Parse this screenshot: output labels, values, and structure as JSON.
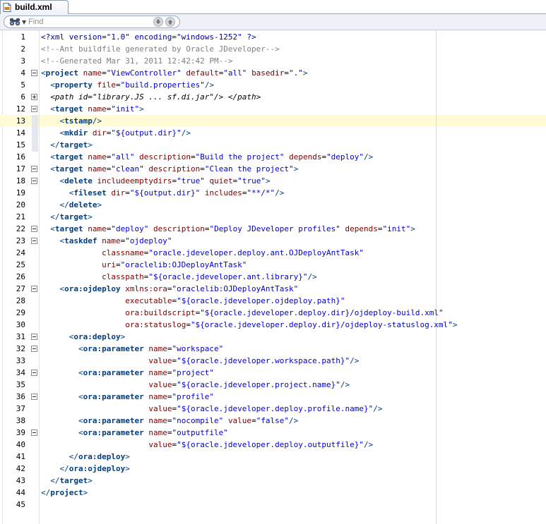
{
  "tab": {
    "title": "build.xml",
    "icon": "xml-file-icon"
  },
  "find": {
    "placeholder": "Find",
    "icon": "binoculars-icon"
  },
  "colors": {
    "tag": "#003d80",
    "attribute": "#7a0000",
    "value": "#0000d0",
    "comment": "#7f7f7f",
    "current_line": "#fffbd6"
  },
  "editor": {
    "lines": [
      {
        "n": "1",
        "fold": "",
        "t": [
          [
            "pi",
            "<?xml version=\"1.0\" encoding=\"windows-1252\" ?>"
          ]
        ]
      },
      {
        "n": "2",
        "fold": "",
        "t": [
          [
            "com",
            "<!--Ant buildfile generated by Oracle JDeveloper-->"
          ]
        ]
      },
      {
        "n": "3",
        "fold": "",
        "t": [
          [
            "com",
            "<!--Generated Mar 31, 2011 12:42:42 PM-->"
          ]
        ]
      },
      {
        "n": "4",
        "fold": "minus",
        "t": [
          [
            "br",
            "<"
          ],
          [
            "tag",
            "project"
          ],
          [
            "txt",
            " "
          ],
          [
            "attr",
            "name"
          ],
          [
            "txt",
            "="
          ],
          [
            "val",
            "\"ViewController\""
          ],
          [
            "txt",
            " "
          ],
          [
            "attr",
            "default"
          ],
          [
            "txt",
            "="
          ],
          [
            "val",
            "\"all\""
          ],
          [
            "txt",
            " "
          ],
          [
            "attr",
            "basedir"
          ],
          [
            "txt",
            "="
          ],
          [
            "val",
            "\".\""
          ],
          [
            "br",
            ">"
          ]
        ]
      },
      {
        "n": "5",
        "fold": "",
        "t": [
          [
            "txt",
            "  "
          ],
          [
            "br",
            "<"
          ],
          [
            "tag",
            "property"
          ],
          [
            "txt",
            " "
          ],
          [
            "attr",
            "file"
          ],
          [
            "txt",
            "="
          ],
          [
            "val",
            "\"build.properties\""
          ],
          [
            "br",
            "/>"
          ]
        ]
      },
      {
        "n": "6",
        "fold": "plus",
        "t": [
          [
            "txt",
            "  "
          ],
          [
            "ital",
            "<path id=\"library.JS ... sf.di.jar\"/> </path>"
          ]
        ]
      },
      {
        "n": "12",
        "fold": "minus",
        "t": [
          [
            "txt",
            "  "
          ],
          [
            "br",
            "<"
          ],
          [
            "tag",
            "target"
          ],
          [
            "txt",
            " "
          ],
          [
            "attr",
            "name"
          ],
          [
            "txt",
            "="
          ],
          [
            "val",
            "\"init\""
          ],
          [
            "br",
            ">"
          ]
        ]
      },
      {
        "n": "13",
        "fold": "",
        "t": [
          [
            "txt",
            "    "
          ],
          [
            "br",
            "<"
          ],
          [
            "tag",
            "tstamp"
          ],
          [
            "br",
            "/>"
          ]
        ]
      },
      {
        "n": "14",
        "fold": "",
        "t": [
          [
            "txt",
            "    "
          ],
          [
            "br",
            "<"
          ],
          [
            "tag",
            "mkdir"
          ],
          [
            "txt",
            " "
          ],
          [
            "attr",
            "dir"
          ],
          [
            "txt",
            "="
          ],
          [
            "val",
            "\"${output.dir}\""
          ],
          [
            "br",
            "/>"
          ]
        ]
      },
      {
        "n": "15",
        "fold": "",
        "t": [
          [
            "txt",
            "  "
          ],
          [
            "br",
            "</"
          ],
          [
            "tag",
            "target"
          ],
          [
            "br",
            ">"
          ]
        ]
      },
      {
        "n": "16",
        "fold": "",
        "t": [
          [
            "txt",
            "  "
          ],
          [
            "br",
            "<"
          ],
          [
            "tag",
            "target"
          ],
          [
            "txt",
            " "
          ],
          [
            "attr",
            "name"
          ],
          [
            "txt",
            "="
          ],
          [
            "val",
            "\"all\""
          ],
          [
            "txt",
            " "
          ],
          [
            "attr",
            "description"
          ],
          [
            "txt",
            "="
          ],
          [
            "val",
            "\"Build the project\""
          ],
          [
            "txt",
            " "
          ],
          [
            "attr",
            "depends"
          ],
          [
            "txt",
            "="
          ],
          [
            "val",
            "\"deploy\""
          ],
          [
            "br",
            "/>"
          ]
        ]
      },
      {
        "n": "17",
        "fold": "minus",
        "t": [
          [
            "txt",
            "  "
          ],
          [
            "br",
            "<"
          ],
          [
            "tag",
            "target"
          ],
          [
            "txt",
            " "
          ],
          [
            "attr",
            "name"
          ],
          [
            "txt",
            "="
          ],
          [
            "val",
            "\"clean\""
          ],
          [
            "txt",
            " "
          ],
          [
            "attr",
            "description"
          ],
          [
            "txt",
            "="
          ],
          [
            "val",
            "\"Clean the project\""
          ],
          [
            "br",
            ">"
          ]
        ]
      },
      {
        "n": "18",
        "fold": "minus",
        "t": [
          [
            "txt",
            "    "
          ],
          [
            "br",
            "<"
          ],
          [
            "tag",
            "delete"
          ],
          [
            "txt",
            " "
          ],
          [
            "attr",
            "includeemptydirs"
          ],
          [
            "txt",
            "="
          ],
          [
            "val",
            "\"true\""
          ],
          [
            "txt",
            " "
          ],
          [
            "attr",
            "quiet"
          ],
          [
            "txt",
            "="
          ],
          [
            "val",
            "\"true\""
          ],
          [
            "br",
            ">"
          ]
        ]
      },
      {
        "n": "19",
        "fold": "",
        "t": [
          [
            "txt",
            "      "
          ],
          [
            "br",
            "<"
          ],
          [
            "tag",
            "fileset"
          ],
          [
            "txt",
            " "
          ],
          [
            "attr",
            "dir"
          ],
          [
            "txt",
            "="
          ],
          [
            "val",
            "\"${output.dir}\""
          ],
          [
            "txt",
            " "
          ],
          [
            "attr",
            "includes"
          ],
          [
            "txt",
            "="
          ],
          [
            "val",
            "\"**/*\""
          ],
          [
            "br",
            "/>"
          ]
        ]
      },
      {
        "n": "20",
        "fold": "",
        "t": [
          [
            "txt",
            "    "
          ],
          [
            "br",
            "</"
          ],
          [
            "tag",
            "delete"
          ],
          [
            "br",
            ">"
          ]
        ]
      },
      {
        "n": "21",
        "fold": "",
        "t": [
          [
            "txt",
            "  "
          ],
          [
            "br",
            "</"
          ],
          [
            "tag",
            "target"
          ],
          [
            "br",
            ">"
          ]
        ]
      },
      {
        "n": "22",
        "fold": "minus",
        "t": [
          [
            "txt",
            "  "
          ],
          [
            "br",
            "<"
          ],
          [
            "tag",
            "target"
          ],
          [
            "txt",
            " "
          ],
          [
            "attr",
            "name"
          ],
          [
            "txt",
            "="
          ],
          [
            "val",
            "\"deploy\""
          ],
          [
            "txt",
            " "
          ],
          [
            "attr",
            "description"
          ],
          [
            "txt",
            "="
          ],
          [
            "val",
            "\"Deploy JDeveloper profiles\""
          ],
          [
            "txt",
            " "
          ],
          [
            "attr",
            "depends"
          ],
          [
            "txt",
            "="
          ],
          [
            "val",
            "\"init\""
          ],
          [
            "br",
            ">"
          ]
        ]
      },
      {
        "n": "23",
        "fold": "minus",
        "t": [
          [
            "txt",
            "    "
          ],
          [
            "br",
            "<"
          ],
          [
            "tag",
            "taskdef"
          ],
          [
            "txt",
            " "
          ],
          [
            "attr",
            "name"
          ],
          [
            "txt",
            "="
          ],
          [
            "val",
            "\"ojdeploy\""
          ]
        ]
      },
      {
        "n": "24",
        "fold": "",
        "t": [
          [
            "txt",
            "             "
          ],
          [
            "attr",
            "classname"
          ],
          [
            "txt",
            "="
          ],
          [
            "val",
            "\"oracle.jdeveloper.deploy.ant.OJDeployAntTask\""
          ]
        ]
      },
      {
        "n": "25",
        "fold": "",
        "t": [
          [
            "txt",
            "             "
          ],
          [
            "attr",
            "uri"
          ],
          [
            "txt",
            "="
          ],
          [
            "val",
            "\"oraclelib:OJDeployAntTask\""
          ]
        ]
      },
      {
        "n": "26",
        "fold": "",
        "t": [
          [
            "txt",
            "             "
          ],
          [
            "attr",
            "classpath"
          ],
          [
            "txt",
            "="
          ],
          [
            "val",
            "\"${oracle.jdeveloper.ant.library}\""
          ],
          [
            "br",
            "/>"
          ]
        ]
      },
      {
        "n": "27",
        "fold": "minus",
        "t": [
          [
            "txt",
            "    "
          ],
          [
            "br",
            "<"
          ],
          [
            "tag",
            "ora:ojdeploy"
          ],
          [
            "txt",
            " "
          ],
          [
            "attr",
            "xmlns:ora"
          ],
          [
            "txt",
            "="
          ],
          [
            "val",
            "\"oraclelib:OJDeployAntTask\""
          ]
        ]
      },
      {
        "n": "28",
        "fold": "",
        "t": [
          [
            "txt",
            "                  "
          ],
          [
            "attr",
            "executable"
          ],
          [
            "txt",
            "="
          ],
          [
            "val",
            "\"${oracle.jdeveloper.ojdeploy.path}\""
          ]
        ]
      },
      {
        "n": "29",
        "fold": "",
        "t": [
          [
            "txt",
            "                  "
          ],
          [
            "attr",
            "ora:buildscript"
          ],
          [
            "txt",
            "="
          ],
          [
            "val",
            "\"${oracle.jdeveloper.deploy.dir}/ojdeploy-build.xml\""
          ]
        ]
      },
      {
        "n": "30",
        "fold": "",
        "t": [
          [
            "txt",
            "                  "
          ],
          [
            "attr",
            "ora:statuslog"
          ],
          [
            "txt",
            "="
          ],
          [
            "val",
            "\"${oracle.jdeveloper.deploy.dir}/ojdeploy-statuslog.xml\""
          ],
          [
            "br",
            ">"
          ]
        ]
      },
      {
        "n": "31",
        "fold": "minus",
        "t": [
          [
            "txt",
            "      "
          ],
          [
            "br",
            "<"
          ],
          [
            "tag",
            "ora:deploy"
          ],
          [
            "br",
            ">"
          ]
        ]
      },
      {
        "n": "32",
        "fold": "minus",
        "t": [
          [
            "txt",
            "        "
          ],
          [
            "br",
            "<"
          ],
          [
            "tag",
            "ora:parameter"
          ],
          [
            "txt",
            " "
          ],
          [
            "attr",
            "name"
          ],
          [
            "txt",
            "="
          ],
          [
            "val",
            "\"workspace\""
          ]
        ]
      },
      {
        "n": "33",
        "fold": "",
        "t": [
          [
            "txt",
            "                       "
          ],
          [
            "attr",
            "value"
          ],
          [
            "txt",
            "="
          ],
          [
            "val",
            "\"${oracle.jdeveloper.workspace.path}\""
          ],
          [
            "br",
            "/>"
          ]
        ]
      },
      {
        "n": "34",
        "fold": "minus",
        "t": [
          [
            "txt",
            "        "
          ],
          [
            "br",
            "<"
          ],
          [
            "tag",
            "ora:parameter"
          ],
          [
            "txt",
            " "
          ],
          [
            "attr",
            "name"
          ],
          [
            "txt",
            "="
          ],
          [
            "val",
            "\"project\""
          ]
        ]
      },
      {
        "n": "35",
        "fold": "",
        "t": [
          [
            "txt",
            "                       "
          ],
          [
            "attr",
            "value"
          ],
          [
            "txt",
            "="
          ],
          [
            "val",
            "\"${oracle.jdeveloper.project.name}\""
          ],
          [
            "br",
            "/>"
          ]
        ]
      },
      {
        "n": "36",
        "fold": "minus",
        "t": [
          [
            "txt",
            "        "
          ],
          [
            "br",
            "<"
          ],
          [
            "tag",
            "ora:parameter"
          ],
          [
            "txt",
            " "
          ],
          [
            "attr",
            "name"
          ],
          [
            "txt",
            "="
          ],
          [
            "val",
            "\"profile\""
          ]
        ]
      },
      {
        "n": "37",
        "fold": "",
        "t": [
          [
            "txt",
            "                       "
          ],
          [
            "attr",
            "value"
          ],
          [
            "txt",
            "="
          ],
          [
            "val",
            "\"${oracle.jdeveloper.deploy.profile.name}\""
          ],
          [
            "br",
            "/>"
          ]
        ]
      },
      {
        "n": "38",
        "fold": "",
        "t": [
          [
            "txt",
            "        "
          ],
          [
            "br",
            "<"
          ],
          [
            "tag",
            "ora:parameter"
          ],
          [
            "txt",
            " "
          ],
          [
            "attr",
            "name"
          ],
          [
            "txt",
            "="
          ],
          [
            "val",
            "\"nocompile\""
          ],
          [
            "txt",
            " "
          ],
          [
            "attr",
            "value"
          ],
          [
            "txt",
            "="
          ],
          [
            "val",
            "\"false\""
          ],
          [
            "br",
            "/>"
          ]
        ]
      },
      {
        "n": "39",
        "fold": "minus",
        "t": [
          [
            "txt",
            "        "
          ],
          [
            "br",
            "<"
          ],
          [
            "tag",
            "ora:parameter"
          ],
          [
            "txt",
            " "
          ],
          [
            "attr",
            "name"
          ],
          [
            "txt",
            "="
          ],
          [
            "val",
            "\"outputfile\""
          ]
        ]
      },
      {
        "n": "40",
        "fold": "",
        "t": [
          [
            "txt",
            "                       "
          ],
          [
            "attr",
            "value"
          ],
          [
            "txt",
            "="
          ],
          [
            "val",
            "\"${oracle.jdeveloper.deploy.outputfile}\""
          ],
          [
            "br",
            "/>"
          ]
        ]
      },
      {
        "n": "41",
        "fold": "",
        "t": [
          [
            "txt",
            "      "
          ],
          [
            "br",
            "</"
          ],
          [
            "tag",
            "ora:deploy"
          ],
          [
            "br",
            ">"
          ]
        ]
      },
      {
        "n": "42",
        "fold": "",
        "t": [
          [
            "txt",
            "    "
          ],
          [
            "br",
            "</"
          ],
          [
            "tag",
            "ora:ojdeploy"
          ],
          [
            "br",
            ">"
          ]
        ]
      },
      {
        "n": "43",
        "fold": "",
        "t": [
          [
            "txt",
            "  "
          ],
          [
            "br",
            "</"
          ],
          [
            "tag",
            "target"
          ],
          [
            "br",
            ">"
          ]
        ]
      },
      {
        "n": "44",
        "fold": "",
        "t": [
          [
            "br",
            "</"
          ],
          [
            "tag",
            "project"
          ],
          [
            "br",
            ">"
          ]
        ]
      },
      {
        "n": "45",
        "fold": "",
        "t": []
      }
    ]
  }
}
